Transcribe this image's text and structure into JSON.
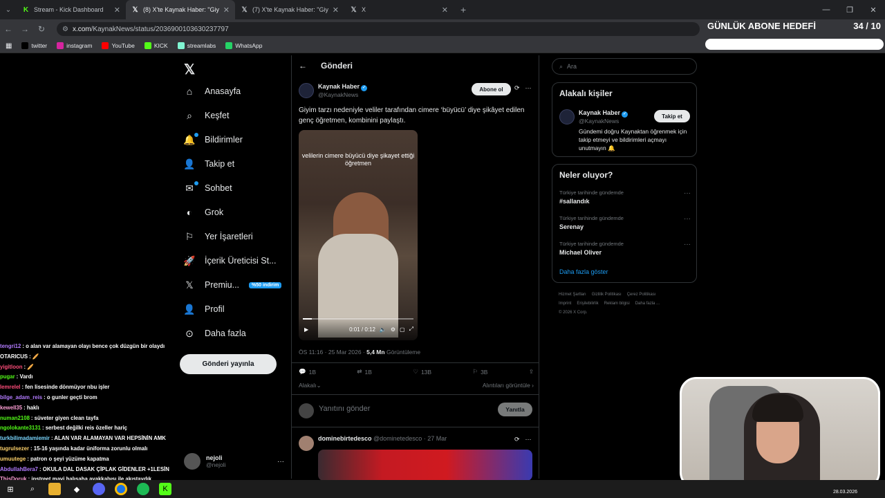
{
  "browser": {
    "tabs": [
      {
        "title": "Stream - Kick Dashboard",
        "icon": "kick-icon",
        "active": false
      },
      {
        "title": "(8) X'te Kaynak Haber: \"Giyim tarzı",
        "icon": "x-logo-icon",
        "active": true
      },
      {
        "title": "(7) X'te Kaynak Haber: \"Giyim tarzı",
        "icon": "x-logo-icon",
        "active": false
      },
      {
        "title": "X",
        "icon": "x-logo-icon",
        "active": false
      }
    ],
    "url_domain": "x.com",
    "url_path": "/KaynakNews/status/2036900103630237797",
    "bookmarks": [
      {
        "label": "twitter",
        "icon": "x-logo-icon",
        "color": "#000000"
      },
      {
        "label": "instagram",
        "icon": "instagram-icon",
        "color": "#d6249f"
      },
      {
        "label": "YouTube",
        "icon": "youtube-icon",
        "color": "#ff0000"
      },
      {
        "label": "KICK",
        "icon": "kick-icon",
        "color": "#53fc18"
      },
      {
        "label": "streamlabs",
        "icon": "streamlabs-icon",
        "color": "#80f5d2"
      },
      {
        "label": "WhatsApp",
        "icon": "whatsapp-icon",
        "color": "#25d366"
      }
    ]
  },
  "goal": {
    "label": "GÜNLÜK ABONE HEDEFİ",
    "count": "34 / 10",
    "progress": 1.0
  },
  "sidebar": {
    "items": [
      {
        "label": "Anasayfa",
        "icon": "home-icon"
      },
      {
        "label": "Keşfet",
        "icon": "search-icon"
      },
      {
        "label": "Bildirimler",
        "icon": "bell-icon"
      },
      {
        "label": "Takip et",
        "icon": "add-user-icon"
      },
      {
        "label": "Sohbet",
        "icon": "mail-icon"
      },
      {
        "label": "Grok",
        "icon": "grok-icon"
      },
      {
        "label": "Yer İşaretleri",
        "icon": "bookmark-icon"
      },
      {
        "label": "İçerik Üreticisi St...",
        "icon": "rocket-icon"
      },
      {
        "label": "Premiu...",
        "icon": "x-logo-icon"
      },
      {
        "label": "Profil",
        "icon": "profile-icon"
      },
      {
        "label": "Daha fazla",
        "icon": "more-circle-icon"
      }
    ],
    "premium_badge": "%50 indirim",
    "post_button": "Gönderi yayınla",
    "user": {
      "name": "nejoli",
      "handle": "@nejoli"
    }
  },
  "chat": [
    {
      "user": "tengri12",
      "color": "#b37bff",
      "msg": "o alan var alamayan olayı bence çok düzgün bir olaydı"
    },
    {
      "user": "OTARICUS",
      "color": "#ffffff",
      "msg": "🥖"
    },
    {
      "user": "yigitloon",
      "color": "#ff4d7a",
      "msg": "🥖"
    },
    {
      "user": "pugar",
      "color": "#53fc18",
      "msg": "Vardı"
    },
    {
      "user": "lemrelel",
      "color": "#ff4d7a",
      "msg": "fen lisesinde dönmüyor nbu işler"
    },
    {
      "user": "bilge_adam_reis",
      "color": "#b37bff",
      "msg": "o gunler geçti brom"
    },
    {
      "user": "kewell35",
      "color": "#ff9fd6",
      "msg": "haklı"
    },
    {
      "user": "numan2108",
      "color": "#53fc18",
      "msg": "süveter giyen clean tayfa"
    },
    {
      "user": "ngolokante3131",
      "color": "#53fc18",
      "msg": "serbest değilki reis özeller hariç"
    },
    {
      "user": "turkbilimadamiemir",
      "color": "#7ad7ff",
      "msg": "ALAN VAR ALAMAYAN VAR HEPSİNİN AMK"
    },
    {
      "user": "tugrulsezer",
      "color": "#ffd36b",
      "msg": "15-16 yaşında kadar üniforma zorunlu olmalı"
    },
    {
      "user": "umuutege",
      "color": "#ffd36b",
      "msg": "patron o şeyi yüzüme kapatma"
    },
    {
      "user": "AbdullahBera7",
      "color": "#b37bff",
      "msg": "OKULA DAL DASAK ÇİPLAK GİDENLER +1LESİN"
    },
    {
      "user": "ThisDoruk",
      "color": "#ff9fd6",
      "msg": "instreet mavi halısaha ayakkabısı ile akıştaydık"
    }
  ],
  "post": {
    "header": "Gönderi",
    "author": "Kaynak Haber",
    "handle": "@KaynakNews",
    "subscribe": "Abone ol",
    "text": "Giyim tarzı nedeniyle veliler tarafından cimere ‘büyücü’ diye şikâyet edilen genç öğretmen, kombinini paylaştı.",
    "video_caption": "velilerin cimere büyücü diye şikayet ettiği öğretmen",
    "video_time": "0:01 / 0:12",
    "video_progress": 0.08,
    "time": "ÖS 11:16 · 25 Mar 2026 · ",
    "views": "5,4 Mn",
    "views_label": "Görüntüleme",
    "replies": "1B",
    "reposts": "1B",
    "likes": "13B",
    "bookmarks": "3B",
    "related": "Alakalı",
    "quotes": "Alıntıları görüntüle",
    "reply_placeholder": "Yanıtını gönder",
    "reply_button": "Yanıtla",
    "next_author": "dominebirtedesco",
    "next_meta": "@dominetedesco · 27 Mar"
  },
  "right": {
    "search_placeholder": "Ara",
    "related_title": "Alakalı kişiler",
    "related_person": {
      "name": "Kaynak Haber",
      "handle": "@KaynakNews",
      "follow": "Takip et",
      "bio": "Gündemi doğru Kaynaktan öğrenmek için takip etmeyi ve bildirimleri açmayı unutmayın 🔔"
    },
    "trends_title": "Neler oluyor?",
    "trends": [
      {
        "context": "Türkiye tarihinde gündemde",
        "name": "#sallandık"
      },
      {
        "context": "Türkiye tarihinde gündemde",
        "name": "Serenay"
      },
      {
        "context": "Türkiye tarihinde gündemde",
        "name": "Michael Oliver"
      }
    ],
    "show_more": "Daha fazla göster",
    "footer": [
      "Hizmet Şartları",
      "Gizlilik Politikası",
      "Çerez Politikası",
      "Imprint",
      "Erişilebilirlik",
      "Reklam bilgisi",
      "Daha fazla ...",
      "© 2026 X Corp."
    ]
  },
  "taskbar": {
    "date": "28.03.2026"
  }
}
